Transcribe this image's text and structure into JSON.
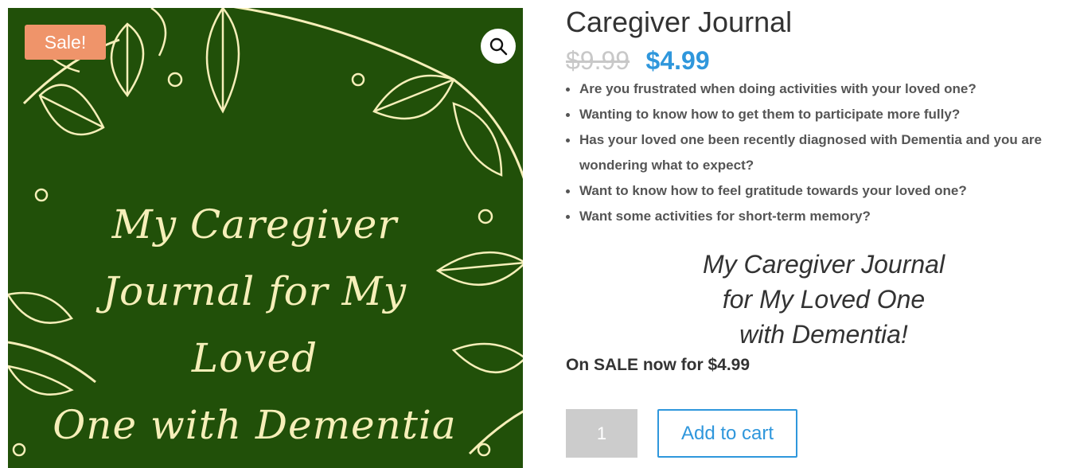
{
  "gallery": {
    "sale_badge": "Sale!",
    "zoom_icon": "magnifier-icon",
    "cover_lines": [
      "My Caregiver",
      "Journal for My",
      "Loved",
      "One with Dementia"
    ],
    "colors": {
      "background": "#215009",
      "ink": "#f6efb9",
      "badge": "#ef946a"
    }
  },
  "product": {
    "title": "Caregiver Journal",
    "price_old": "$9.99",
    "price_new": "$4.99",
    "bullets": [
      "Are you frustrated when doing activities with your loved one?",
      "Wanting to know how to get them to participate more fully?",
      "Has your loved one been recently diagnosed with Dementia and you are wondering what to expect?",
      "Want to know how to feel gratitude towards your loved one?",
      "Want some activities for short-term memory?"
    ],
    "tagline_lines": [
      "My Caregiver Journal",
      "for My Loved One",
      "with Dementia!"
    ],
    "sale_line": "On SALE now for $4.99",
    "quantity": "1",
    "add_to_cart_label": "Add to cart",
    "colors": {
      "accent": "#2f97dc",
      "old_price": "#c8c8c8"
    }
  }
}
